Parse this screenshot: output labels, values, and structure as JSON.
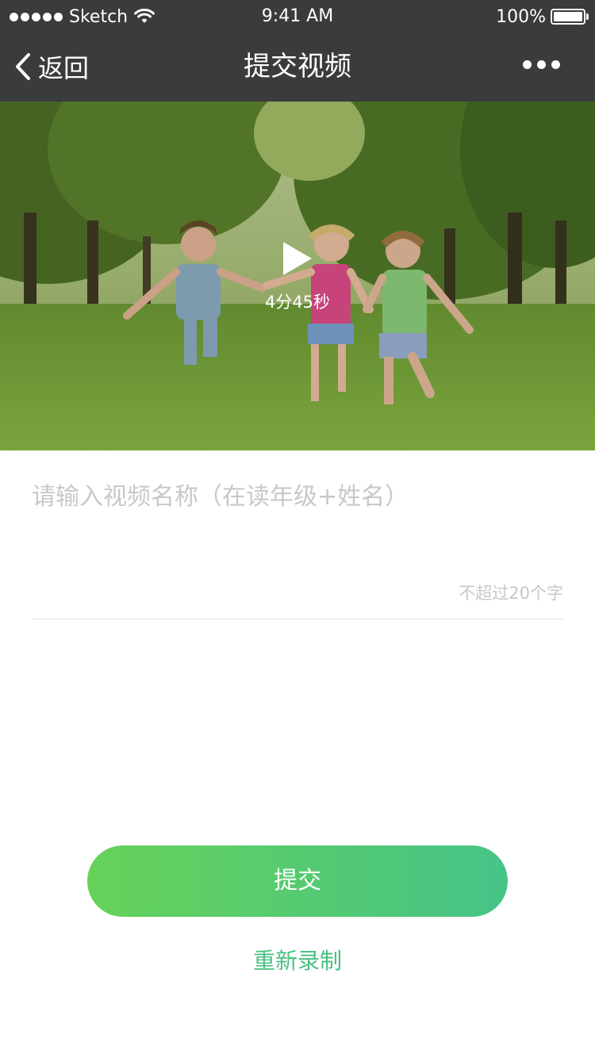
{
  "status_bar": {
    "carrier": "Sketch",
    "time": "9:41 AM",
    "battery": "100%",
    "signal_icon": "signal-dots-icon",
    "wifi_icon": "wifi-icon",
    "battery_icon": "battery-icon"
  },
  "nav": {
    "back_label": "返回",
    "title": "提交视频",
    "back_icon": "chevron-left-icon",
    "more_icon": "more-dots-icon"
  },
  "video": {
    "duration": "4分45秒",
    "play_icon": "play-icon"
  },
  "form": {
    "name_placeholder": "请输入视频名称（在读年级+姓名）",
    "name_value": "",
    "limit_hint": "不超过20个字"
  },
  "actions": {
    "submit_label": "提交",
    "rerecord_label": "重新录制"
  },
  "colors": {
    "nav_bg": "#3a3b3d",
    "accent_green": "#48c081",
    "button_gradient_start": "#66d25a",
    "button_gradient_end": "#46c387",
    "placeholder": "#c8c8c8"
  }
}
